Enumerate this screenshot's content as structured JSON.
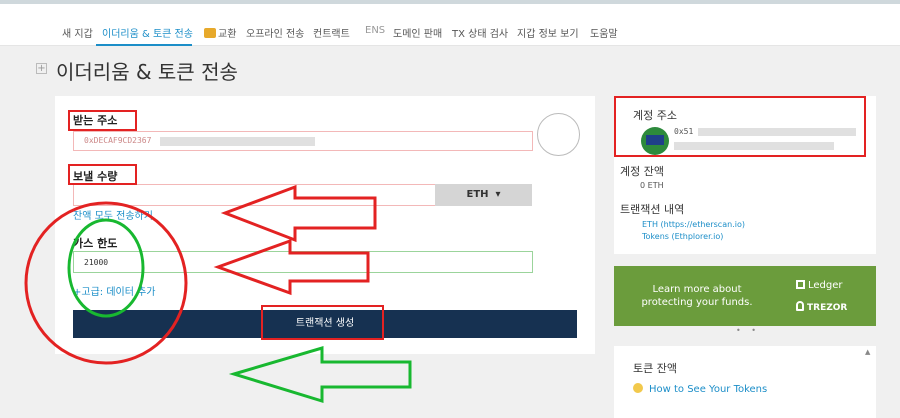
{
  "nav": {
    "items": [
      "새 지갑",
      "이더리움 & 토큰 전송",
      "교환",
      "오프라인 전송",
      "컨트랙트",
      "ENS",
      "도메인 판매",
      "TX 상태 검사",
      "지갑 정보 보기",
      "도움말"
    ]
  },
  "page": {
    "title": "이더리움 & 토큰 전송",
    "expand_symbol": "+"
  },
  "form": {
    "to_address_label": "받는 주소",
    "to_address_value": "0xDECAF9CD2367",
    "amount_label": "보낼 수량",
    "currency": "ETH",
    "currency_caret": "▾",
    "send_all_link": "잔액 모두 전송하기",
    "gas_label": "가스 한도",
    "gas_value": "21000",
    "advanced_link": "+고급: 데이터 추가",
    "generate_button": "트랜잭션 생성"
  },
  "account": {
    "address_label": "계정 주소",
    "address_prefix": "0x51",
    "balance_label": "계정 잔액",
    "balance_value": "0 ETH",
    "history_label": "트랜잭션 내역",
    "history_link_eth": "ETH (https://etherscan.io)",
    "history_link_tokens": "Tokens (Ethplorer.io)"
  },
  "banner": {
    "text_line1": "Learn more about",
    "text_line2": "protecting your funds.",
    "brand1": "Ledger",
    "brand2": "TREZOR",
    "pager": "• •",
    "color": "#6b9c3c"
  },
  "tokens": {
    "label": "토큰 잔액",
    "link": "How to See Your Tokens"
  },
  "colors": {
    "accent": "#1c8ec8",
    "primary_button": "#163151",
    "annotation_red": "#e32222",
    "annotation_green": "#18b830"
  }
}
